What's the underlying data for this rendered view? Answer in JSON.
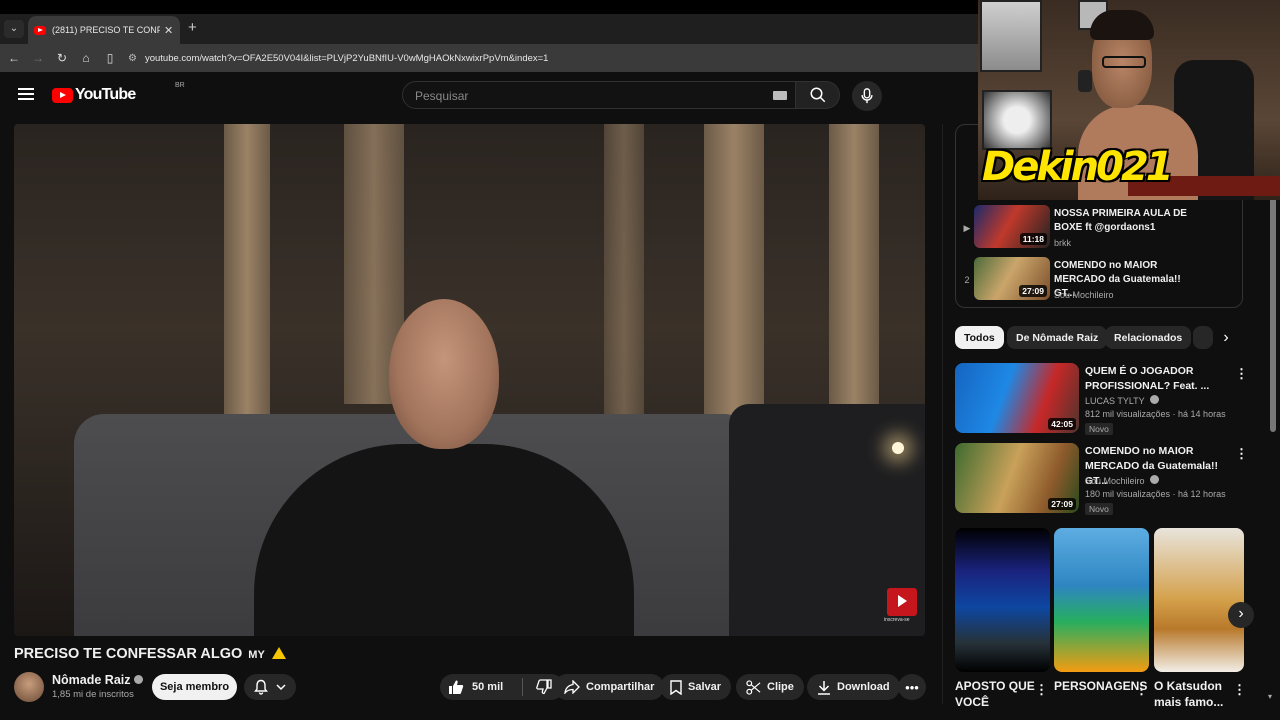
{
  "browser": {
    "tab_title": "(2811) PRECISO TE CONFESSAR",
    "url": "youtube.com/watch?v=OFA2E50V04I&list=PLVjP2YuBNfIU-V0wMgHAOkNxwixrPpVm&index=1"
  },
  "header": {
    "logo_text": "YouTube",
    "country_code": "BR",
    "search_placeholder": "Pesquisar"
  },
  "video": {
    "watermark_text": "inscreva-se",
    "title": "PRECISO TE CONFESSAR ALGO",
    "title_suffix": "MY",
    "channel_name": "Nômade Raiz",
    "subscribers": "1,85 mi de inscritos",
    "member_label": "Seja membro",
    "likes": "50 mil",
    "share_label": "Compartilhar",
    "save_label": "Salvar",
    "clip_label": "Clipe",
    "download_label": "Download"
  },
  "playlist": {
    "items": [
      {
        "index": "▶",
        "title": "NOSSA PRIMEIRA AULA DE BOXE ft @gordaons1",
        "channel": "brkk",
        "duration": "11:18"
      },
      {
        "index": "2",
        "title": "COMENDO no MAIOR MERCADO da Guatemala!! GT...",
        "channel": "Sou Mochileiro",
        "duration": "27:09"
      }
    ]
  },
  "chips": [
    "Todos",
    "De Nômade Raiz",
    "Relacionados"
  ],
  "recommendations": [
    {
      "title": "QUEM É O JOGADOR PROFISSIONAL? Feat. ...",
      "channel": "LUCAS TYLTY",
      "meta": "812 mil visualizações · há 14 horas",
      "badge": "Novo",
      "duration": "42:05"
    },
    {
      "title": "COMENDO no MAIOR MERCADO da Guatemala!! GT...",
      "channel": "Sou Mochileiro",
      "meta": "180 mil visualizações · há 12 horas",
      "badge": "Novo",
      "duration": "27:09"
    }
  ],
  "shorts": [
    {
      "label": "APOSTO QUE VOCÊ"
    },
    {
      "label": "PERSONAGENS"
    },
    {
      "label": "O Katsudon mais famo..."
    }
  ],
  "webcam": {
    "streamer_name": "Dekin021"
  },
  "colors": {
    "background": "#0f0f0f",
    "youtube_red": "#ff0000",
    "overlay_yellow": "#ffe500"
  }
}
